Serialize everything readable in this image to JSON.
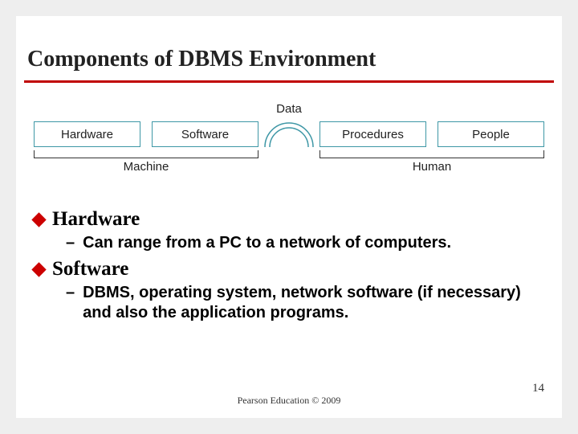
{
  "title": "Components of DBMS Environment",
  "diagram": {
    "data_label": "Data",
    "boxes": [
      "Hardware",
      "Software",
      "Procedures",
      "People"
    ],
    "brackets": {
      "left": "Machine",
      "right": "Human"
    }
  },
  "bullets": [
    {
      "heading": "Hardware",
      "sub": "Can range from a PC to a network of computers."
    },
    {
      "heading": "Software",
      "sub": "DBMS, operating system, network software (if necessary) and also the application programs."
    }
  ],
  "footer": "Pearson Education © 2009",
  "page_number": "14"
}
